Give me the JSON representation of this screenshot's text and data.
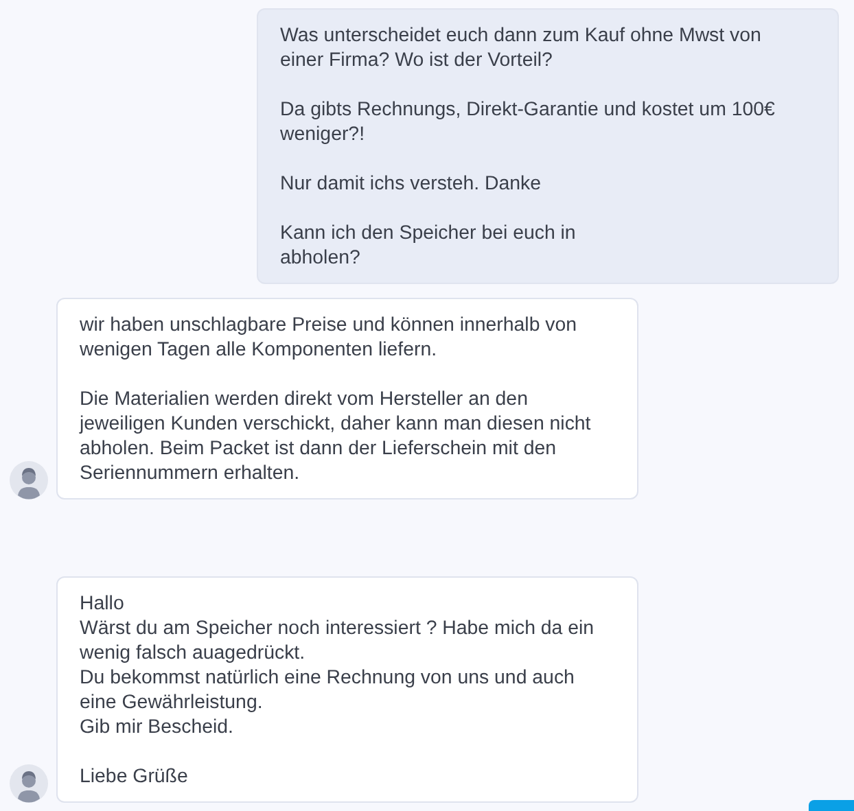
{
  "messages": [
    {
      "kind": "outgoing",
      "paragraphs": [
        "Was unterscheidet euch dann zum Kauf ohne Mwst von\neiner Firma? Wo ist der Vorteil?",
        "Da gibts Rechnungs, Direkt-Garantie und kostet um 100€\nweniger?!",
        "Nur damit ichs versteh. Danke",
        "Kann ich den Speicher bei euch in\nabholen?"
      ]
    },
    {
      "kind": "incoming",
      "paragraphs": [
        "wir haben unschlagbare Preise und können innerhalb von\nwenigen Tagen alle Komponenten liefern.",
        "Die Materialien werden direkt vom Hersteller an den\njeweiligen Kunden verschickt, daher kann man diesen nicht\nabholen. Beim Packet ist dann der Lieferschein mit den\nSeriennummern erhalten."
      ]
    },
    {
      "kind": "incoming",
      "paragraphs": [
        "Hallo\nWärst du am Speicher noch interessiert ? Habe mich da ein\nwenig falsch auagedrückt.\nDu bekommst natürlich eine Rechnung von uns und auch\neine Gewährleistung.\nGib mir Bescheid.",
        "Liebe Grüße"
      ]
    }
  ]
}
